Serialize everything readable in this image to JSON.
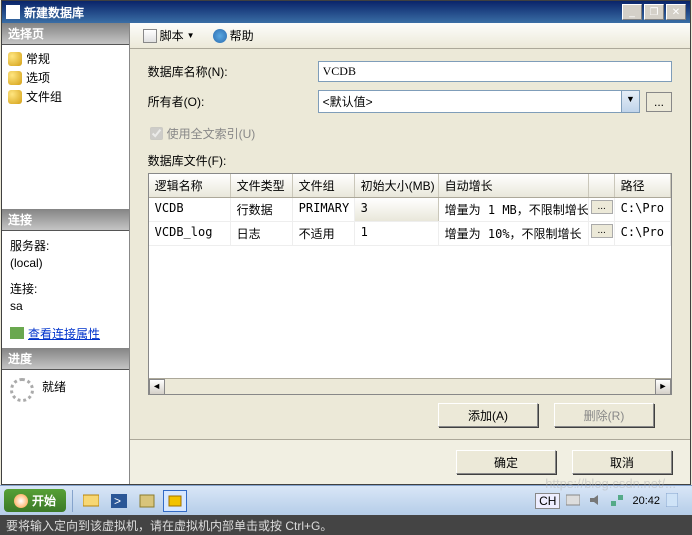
{
  "window": {
    "title": "新建数据库"
  },
  "winbtns": {
    "min": "_",
    "restore": "❐",
    "close": "✕"
  },
  "left": {
    "select_page": "选择页",
    "nav": [
      "常规",
      "选项",
      "文件组"
    ],
    "connect_hdr": "连接",
    "server_lbl": "服务器:",
    "server_val": "(local)",
    "conn_lbl": "连接:",
    "conn_val": "sa",
    "view_props": "查看连接属性",
    "progress_hdr": "进度",
    "progress_val": "就绪"
  },
  "toolbar": {
    "script": "脚本",
    "help": "帮助"
  },
  "form": {
    "dbname_lbl": "数据库名称(N):",
    "dbname_val": "VCDB",
    "owner_lbl": "所有者(O):",
    "owner_val": "<默认值>",
    "fulltext_lbl": "使用全文索引(U)",
    "files_lbl": "数据库文件(F):",
    "ellipsis": "..."
  },
  "table": {
    "headers": {
      "logical": "逻辑名称",
      "filetype": "文件类型",
      "filegroup": "文件组",
      "initsize": "初始大小(MB)",
      "autogrow": "自动增长",
      "path": "路径"
    },
    "rows": [
      {
        "logical": "VCDB",
        "filetype": "行数据",
        "filegroup": "PRIMARY",
        "initsize": "3",
        "autogrow": "增量为 1 MB，不限制增长",
        "path": "C:\\Pro"
      },
      {
        "logical": "VCDB_log",
        "filetype": "日志",
        "filegroup": "不适用",
        "initsize": "1",
        "autogrow": "增量为 10%，不限制增长",
        "path": "C:\\Pro"
      }
    ]
  },
  "buttons": {
    "add": "添加(A)",
    "delete": "删除(R)",
    "ok": "确定",
    "cancel": "取消"
  },
  "scroll": {
    "left": "◄",
    "right": "►"
  },
  "taskbar": {
    "start": "开始",
    "lang": "CH",
    "time": "20:42"
  },
  "status": {
    "text": "要将输入定向到该虚拟机，请在虚拟机内部单击或按 Ctrl+G。"
  },
  "watermark": "https://blog.csdn.net/... "
}
